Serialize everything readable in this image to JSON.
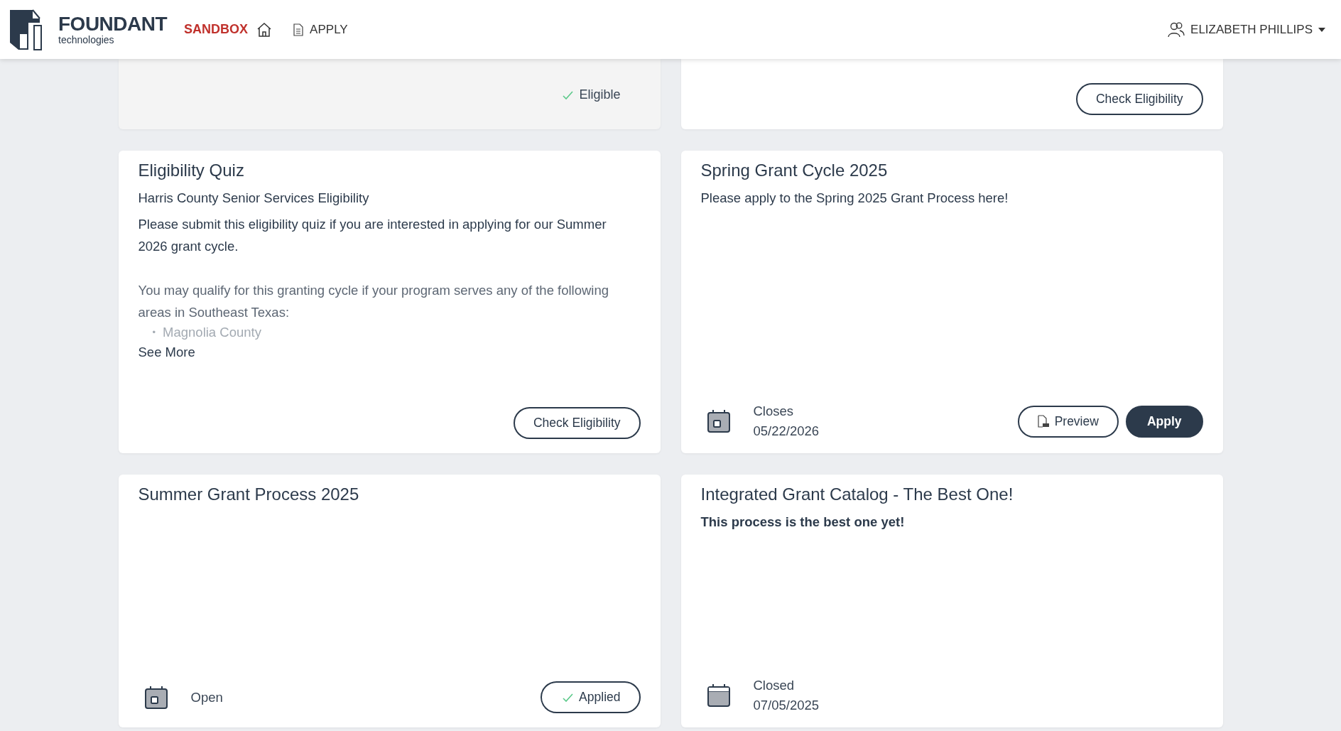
{
  "header": {
    "logo_word": "FOUNDANT",
    "logo_sub": "technologies",
    "environment": "SANDBOX",
    "nav": [
      {
        "label": "APPLY"
      }
    ],
    "user": "ELIZABETH PHILLIPS"
  },
  "cards": [
    {
      "footer": {
        "status": {
          "kind": "eligible",
          "label": "Eligible"
        }
      }
    },
    {
      "footer": {
        "buttons": [
          {
            "kind": "outline",
            "label": "Check Eligibility"
          }
        ]
      }
    },
    {
      "title": "Eligibility Quiz",
      "subtitle": "Harris County Senior Services Eligibility",
      "description": [
        "Please submit this eligibility quiz if you are interested in applying for our Summer 2026 grant cycle.",
        "You may qualify for this granting cycle if your program serves any of the following areas in Southeast Texas:"
      ],
      "list": [
        {
          "marker": "•",
          "text": "Magnolia County"
        }
      ],
      "see_more": "See More",
      "footer": {
        "buttons": [
          {
            "kind": "outline",
            "label": "Check Eligibility"
          }
        ]
      }
    },
    {
      "title": "Spring Grant Cycle 2025",
      "subtitle": "Please apply to the Spring 2025 Grant Process here!",
      "subtitle_bold": false,
      "footer": {
        "date": {
          "kind": "open",
          "label": "Closes",
          "value": "05/22/2026"
        },
        "buttons": [
          {
            "kind": "preview",
            "label": "Preview"
          },
          {
            "kind": "primary",
            "label": "Apply"
          }
        ]
      }
    },
    {
      "title": "Summer Grant Process 2025",
      "footer": {
        "date": {
          "kind": "open",
          "label": "Open"
        },
        "buttons": [
          {
            "kind": "applied",
            "label": "Applied"
          }
        ]
      }
    },
    {
      "title": "Integrated Grant Catalog - The Best One!",
      "subtitle": "This process is the best one yet!",
      "subtitle_bold": true,
      "footer": {
        "date": {
          "kind": "closed",
          "label": "Closed",
          "value": "07/05/2025"
        }
      }
    }
  ]
}
